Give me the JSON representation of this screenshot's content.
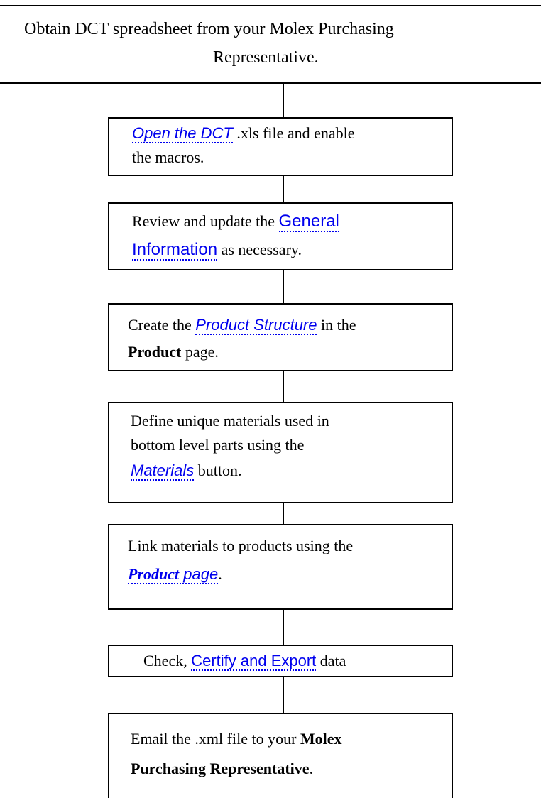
{
  "header": {
    "line1": "Obtain DCT spreadsheet from your Molex Purchasing",
    "line2": "Representative."
  },
  "steps": [
    {
      "link": "Open the DCT",
      "rest_line1": " .xls file and enable",
      "line2": "the macros."
    },
    {
      "pre": "Review and update the ",
      "link_line1": "General",
      "link_line2": "Information",
      "post_line2": " as necessary."
    },
    {
      "pre": "Create the ",
      "link": "Product Structure",
      "post_line1": " in the",
      "bold_line2": "Product",
      "post_line2": " page."
    },
    {
      "line1": "Define unique materials used in",
      "line2": "bottom level parts using the",
      "link": "Materials",
      "post_line3": " button."
    },
    {
      "line1": "Link materials to products using the",
      "link_bold": "Product",
      "link_rest": " page",
      "post_line2": "."
    },
    {
      "pre": "Check, ",
      "link": "Certify and Export",
      "post": " data"
    },
    {
      "pre": "Email the .xml file to your ",
      "bold_line1": "Molex",
      "bold_line2": "Purchasing Representative",
      "post_line2": "."
    }
  ]
}
